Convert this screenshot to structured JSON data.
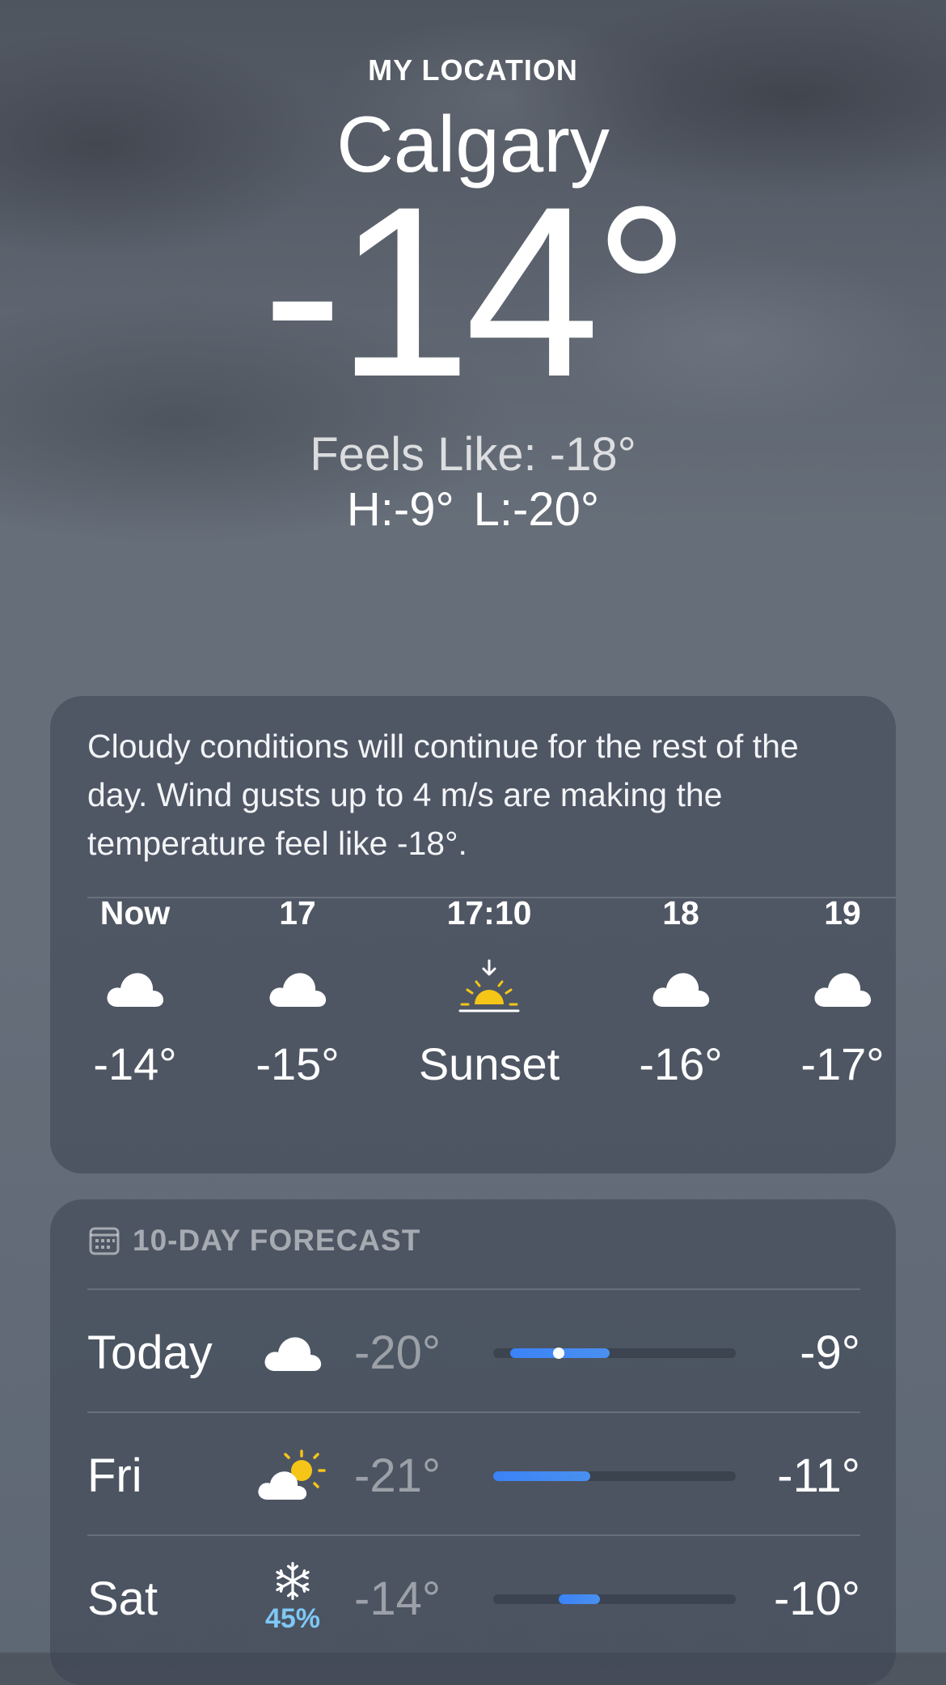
{
  "header": {
    "location_label": "MY LOCATION",
    "city": "Calgary",
    "current_temp": "-14°",
    "feels_like": "Feels Like: -18°",
    "high": "H:-9°",
    "low": "L:-20°"
  },
  "hourly": {
    "summary": "Cloudy conditions will continue for the rest of the day. Wind gusts up to 4 m/s are making the temperature feel like -18°.",
    "items": [
      {
        "time": "Now",
        "icon": "cloud-icon",
        "temp": "-14°"
      },
      {
        "time": "17",
        "icon": "cloud-icon",
        "temp": "-15°"
      },
      {
        "time": "17:10",
        "icon": "sunset-icon",
        "temp": "Sunset"
      },
      {
        "time": "18",
        "icon": "cloud-icon",
        "temp": "-16°"
      },
      {
        "time": "19",
        "icon": "cloud-icon",
        "temp": "-17°"
      }
    ]
  },
  "forecast": {
    "title": "10-DAY FORECAST",
    "days": [
      {
        "day": "Today",
        "icon": "cloud-icon",
        "precip": "",
        "low": "-20°",
        "high": "-9°",
        "range_start": 0.07,
        "range_end": 0.48,
        "current": 0.27
      },
      {
        "day": "Fri",
        "icon": "partly-sunny-icon",
        "precip": "",
        "low": "-21°",
        "high": "-11°",
        "range_start": 0.0,
        "range_end": 0.4
      },
      {
        "day": "Sat",
        "icon": "snowflake-icon",
        "precip": "45%",
        "low": "-14°",
        "high": "-10°",
        "range_start": 0.27,
        "range_end": 0.44
      }
    ]
  },
  "colors": {
    "bar_fill": "#3b82f6",
    "sun_yellow": "#f5c518",
    "precip_blue": "#7ec8f5"
  }
}
